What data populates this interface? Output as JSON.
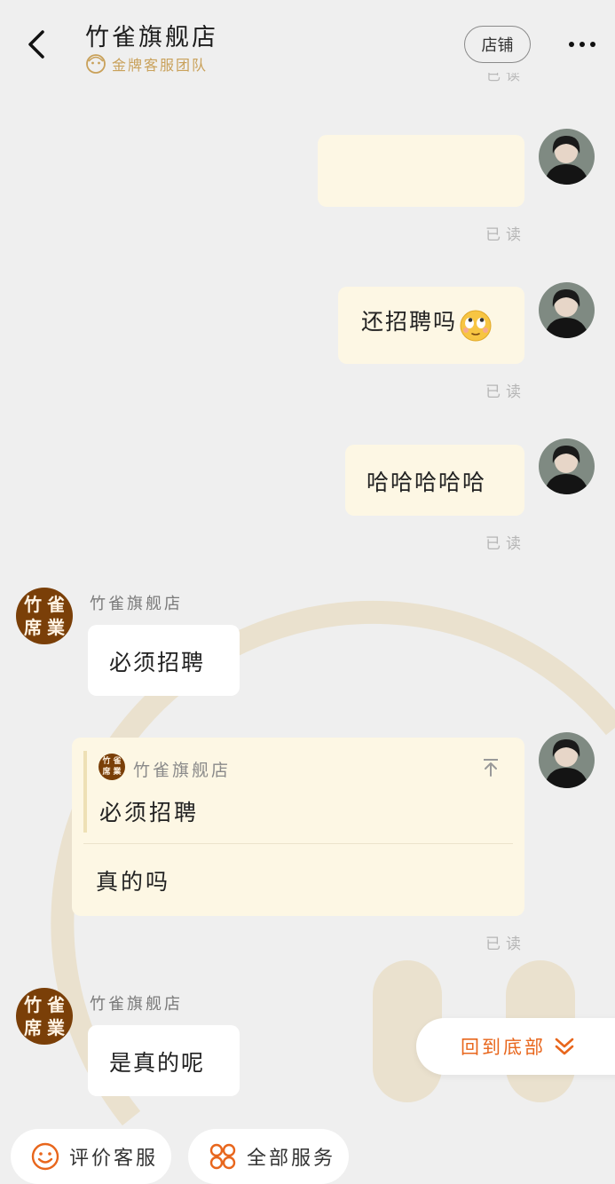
{
  "header": {
    "title": "竹雀旗舰店",
    "badge": "金牌客服团队",
    "store_button": "店铺"
  },
  "truncated_above": "已读",
  "colors": {
    "my_bubble": "#fdf7e4",
    "shop_bubble": "#ffffff",
    "accent": "#e8661c",
    "badge_gold": "#c9a15a",
    "shop_avatar_bg": "#7a3f08"
  },
  "shop_avatar_text": [
    "竹",
    "雀",
    "席",
    "業"
  ],
  "messages": [
    {
      "from": "me",
      "text": "",
      "status": "已读"
    },
    {
      "from": "me",
      "text": "还招聘吗",
      "emoji": "rolling-eyes-emoji",
      "status": "已读"
    },
    {
      "from": "me",
      "text": "哈哈哈哈哈",
      "status": "已读"
    },
    {
      "from": "shop",
      "sender": "竹雀旗舰店",
      "text": "必须招聘"
    },
    {
      "from": "me",
      "quote": {
        "sender": "竹雀旗舰店",
        "text": "必须招聘"
      },
      "text": "真的吗",
      "status": "已读"
    },
    {
      "from": "shop",
      "sender": "竹雀旗舰店",
      "text": "是真的呢"
    }
  ],
  "back_to_bottom": "回到底部",
  "bottom_actions": [
    {
      "label": "评价客服",
      "icon": "smile-icon"
    },
    {
      "label": "全部服务",
      "icon": "grid-icon"
    }
  ]
}
